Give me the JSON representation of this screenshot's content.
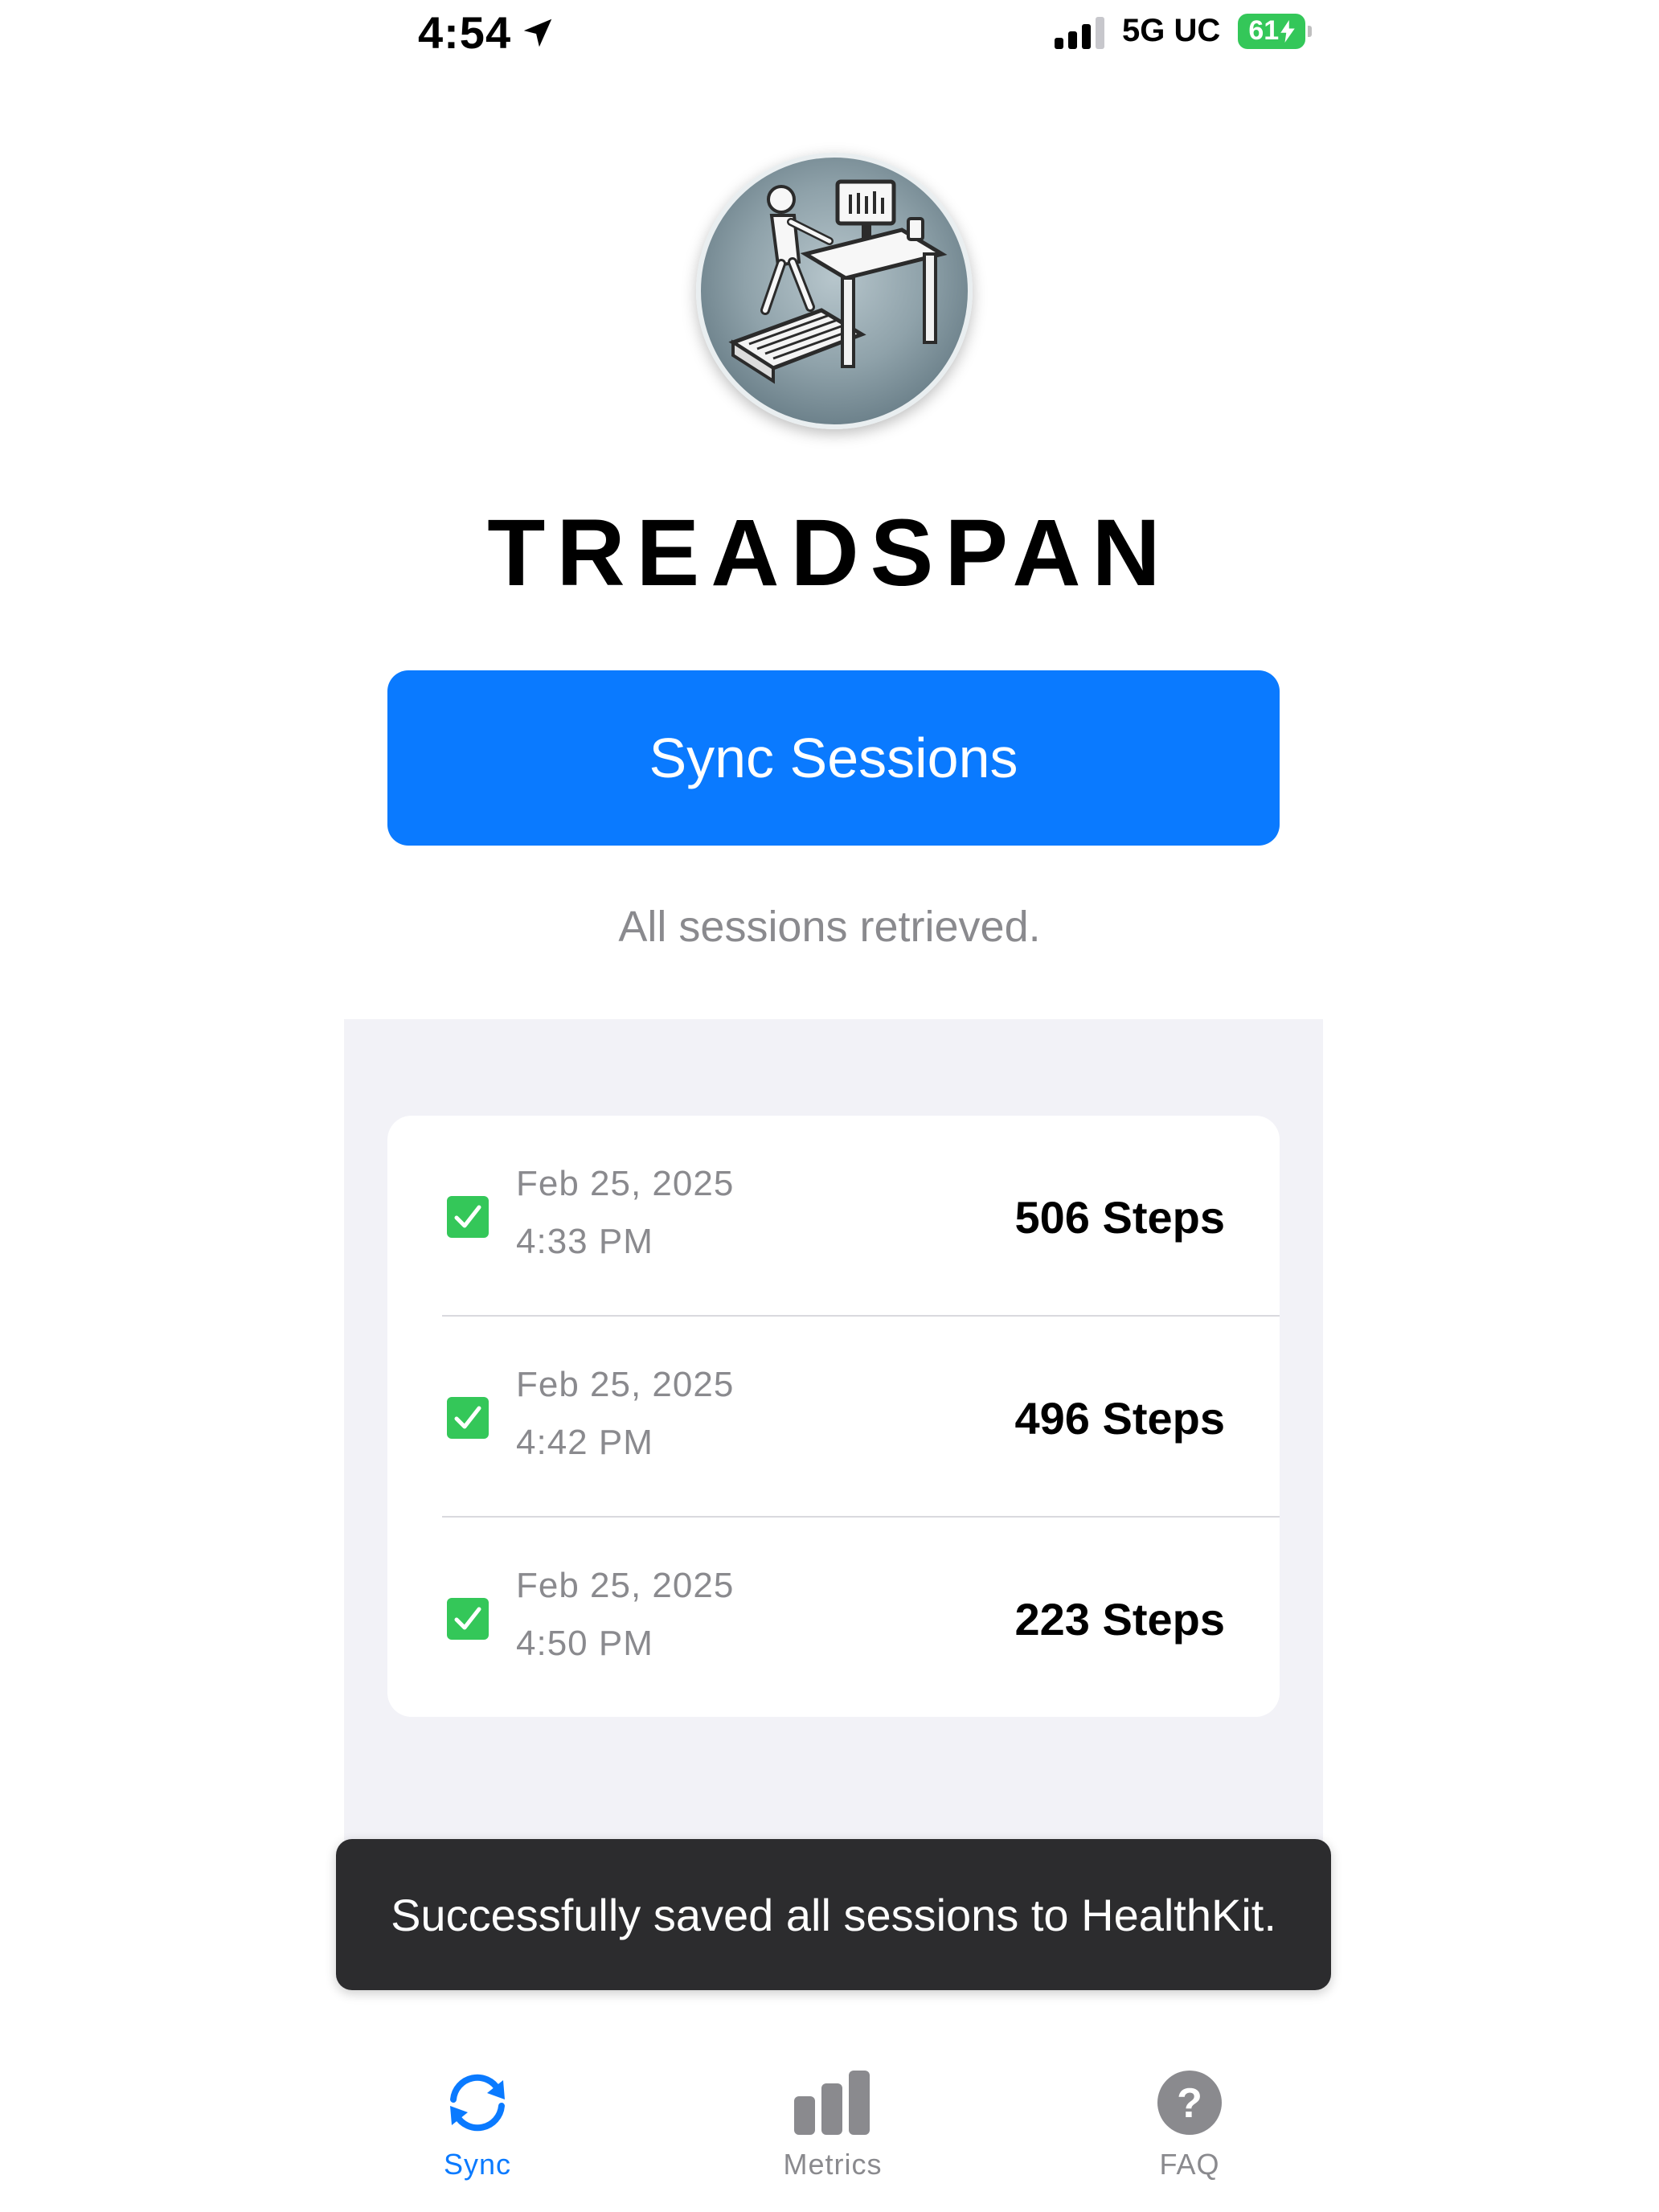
{
  "status_bar": {
    "time": "4:54",
    "network": "5G UC",
    "battery": "61"
  },
  "app": {
    "title": "TREADSPAN",
    "logo_icon": "treadmill-desk-logo"
  },
  "sync_button": {
    "label": "Sync Sessions"
  },
  "status_message": "All sessions retrieved.",
  "sessions": [
    {
      "date": "Feb 25, 2025",
      "time": "4:33 PM",
      "steps": "506 Steps",
      "checked": true
    },
    {
      "date": "Feb 25, 2025",
      "time": "4:42 PM",
      "steps": "496 Steps",
      "checked": true
    },
    {
      "date": "Feb 25, 2025",
      "time": "4:50 PM",
      "steps": "223 Steps",
      "checked": true
    }
  ],
  "toast": {
    "message": "Successfully saved all sessions to HealthKit."
  },
  "tabs": [
    {
      "label": "Sync",
      "icon": "sync-icon",
      "active": true
    },
    {
      "label": "Metrics",
      "icon": "bar-chart-icon",
      "active": false
    },
    {
      "label": "FAQ",
      "icon": "question-icon",
      "active": false
    }
  ],
  "colors": {
    "accent": "#0a7aff",
    "check": "#34c759",
    "toast_bg": "#2c2c2e",
    "panel_bg": "#f2f2f7",
    "secondary_text": "#8a8a8e"
  }
}
